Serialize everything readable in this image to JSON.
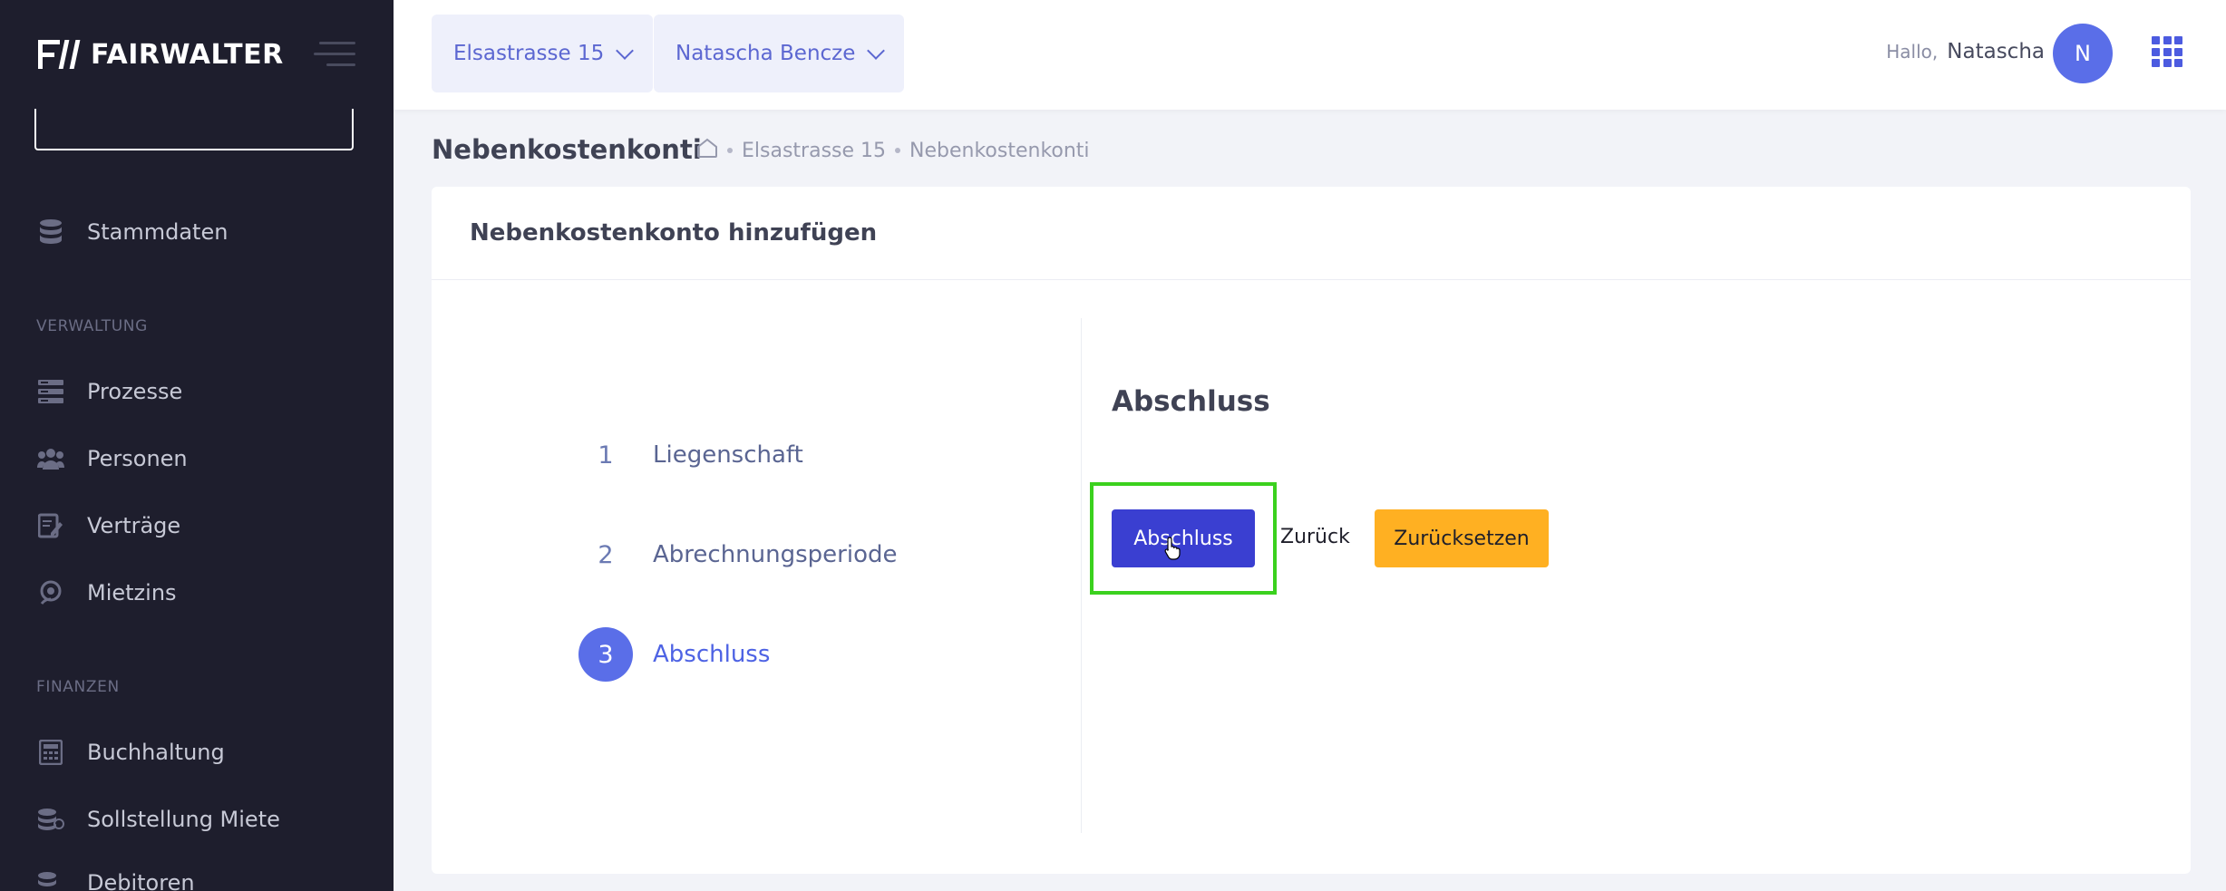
{
  "brand": {
    "name": "FAIRWALTER"
  },
  "sidebar": {
    "items_top": [
      {
        "label": "Stammdaten",
        "icon": "database-icon"
      }
    ],
    "section_verwaltung": "VERWALTUNG",
    "items_verwaltung": [
      {
        "label": "Prozesse",
        "icon": "process-icon"
      },
      {
        "label": "Personen",
        "icon": "people-icon"
      },
      {
        "label": "Verträge",
        "icon": "contract-icon"
      },
      {
        "label": "Mietzins",
        "icon": "rent-icon"
      }
    ],
    "section_finanzen": "FINANZEN",
    "items_finanzen": [
      {
        "label": "Buchhaltung",
        "icon": "calculator-icon"
      },
      {
        "label": "Sollstellung Miete",
        "icon": "coins-icon"
      },
      {
        "label": "Debitoren",
        "icon": "coins-icon"
      }
    ]
  },
  "header": {
    "property_select": "Elsastrasse 15",
    "user_select": "Natascha Bencze",
    "greeting": "Hallo,",
    "user_name": "Natascha",
    "avatar_initial": "N"
  },
  "subheader": {
    "title": "Nebenkostenkonti",
    "breadcrumb": [
      "Elsastrasse 15",
      "Nebenkostenkonti"
    ]
  },
  "card": {
    "title": "Nebenkostenkonto hinzufügen",
    "steps": [
      {
        "num": "1",
        "label": "Liegenschaft"
      },
      {
        "num": "2",
        "label": "Abrechnungsperiode"
      },
      {
        "num": "3",
        "label": "Abschluss"
      }
    ],
    "section_title": "Abschluss",
    "buttons": {
      "submit": "Abschluss",
      "back": "Zurück",
      "reset": "Zurücksetzen"
    }
  },
  "colors": {
    "sidebar_bg": "#1e1e2d",
    "accent": "#5a6ee8",
    "primary_button": "#3a3fd1",
    "warning_button": "#ffb022",
    "focus_highlight": "#3bd11e"
  }
}
